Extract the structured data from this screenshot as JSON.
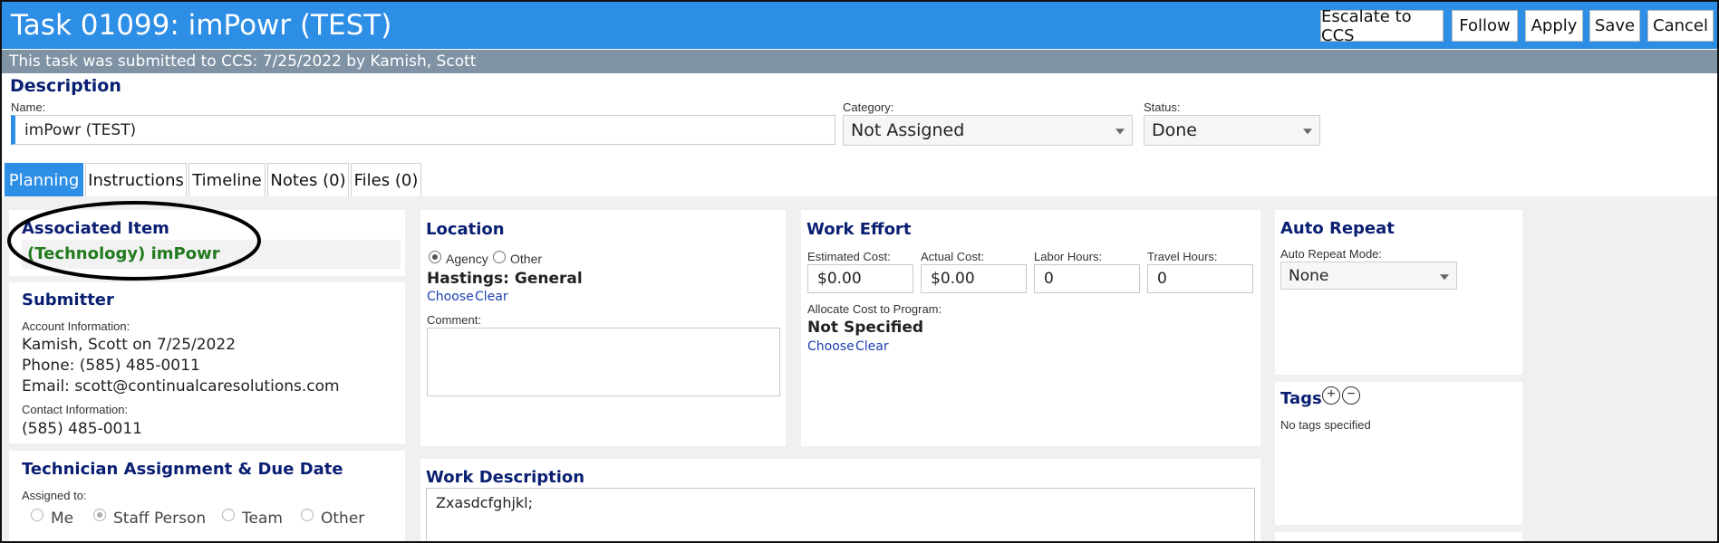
{
  "header": {
    "title": "Task 01099: imPowr (TEST)",
    "buttons": {
      "escalate": "Escalate to CCS",
      "follow": "Follow",
      "apply": "Apply",
      "save": "Save",
      "cancel": "Cancel"
    }
  },
  "notice": "This task was submitted to CCS: 7/25/2022 by Kamish, Scott",
  "description": {
    "section_title": "Description",
    "name_label": "Name:",
    "name_value": "imPowr (TEST)",
    "category_label": "Category:",
    "category_value": "Not Assigned",
    "status_label": "Status:",
    "status_value": "Done"
  },
  "tabs": [
    {
      "label": "Planning",
      "active": true
    },
    {
      "label": "Instructions"
    },
    {
      "label": "Timeline"
    },
    {
      "label": "Notes (0)"
    },
    {
      "label": "Files (0)"
    }
  ],
  "associated_item": {
    "title": "Associated Item",
    "value": "(Technology) imPowr"
  },
  "submitter": {
    "title": "Submitter",
    "account_label": "Account Information:",
    "account_line1": "Kamish, Scott on 7/25/2022",
    "phone": "Phone: (585) 485-0011",
    "email": "Email: scott@continualcaresolutions.com",
    "contact_label": "Contact Information:",
    "contact_phone": "(585) 485-0011"
  },
  "technician": {
    "title": "Technician Assignment & Due Date",
    "assigned_label": "Assigned to:",
    "options": [
      "Me",
      "Staff Person",
      "Team",
      "Other"
    ]
  },
  "location": {
    "title": "Location",
    "option_agency": "Agency",
    "option_other": "Other",
    "value": "Hastings: General",
    "choose": "Choose",
    "clear": "Clear",
    "comment_label": "Comment:"
  },
  "work_effort": {
    "title": "Work Effort",
    "estimated_cost_label": "Estimated Cost:",
    "estimated_cost": "$0.00",
    "actual_cost_label": "Actual Cost:",
    "actual_cost": "$0.00",
    "labor_hours_label": "Labor Hours:",
    "labor_hours": "0",
    "travel_hours_label": "Travel Hours:",
    "travel_hours": "0",
    "allocate_label": "Allocate Cost to Program:",
    "allocate_value": "Not Specified",
    "choose": "Choose",
    "clear": "Clear"
  },
  "work_description": {
    "title": "Work Description",
    "value": "Zxasdcfghjkl;"
  },
  "auto_repeat": {
    "title": "Auto Repeat",
    "mode_label": "Auto Repeat Mode:",
    "mode_value": "None"
  },
  "tags": {
    "title": "Tags",
    "empty": "No tags specified"
  }
}
